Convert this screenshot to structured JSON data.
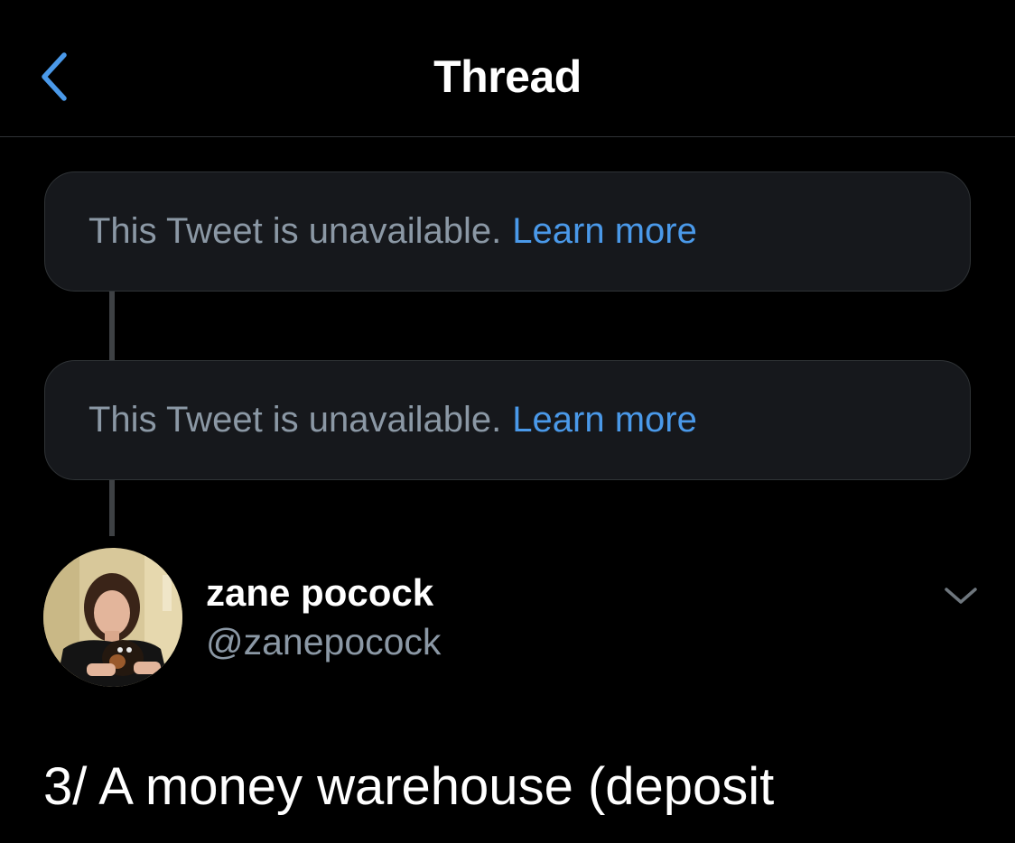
{
  "header": {
    "title": "Thread",
    "back_icon": "chevron-left-icon"
  },
  "colors": {
    "background": "#000000",
    "card_background": "#16181c",
    "link": "#4a99e9",
    "muted_text": "#8b98a5",
    "divider": "#2f3336"
  },
  "thread": {
    "unavailable_items": [
      {
        "message": "This Tweet is unavailable.",
        "link_label": "Learn more"
      },
      {
        "message": "This Tweet is unavailable.",
        "link_label": "Learn more"
      }
    ],
    "tweet": {
      "author_name": "zane pocock",
      "author_handle": "@zanepocock",
      "more_icon": "chevron-down-icon",
      "text": "3/ A money warehouse (deposit"
    }
  }
}
